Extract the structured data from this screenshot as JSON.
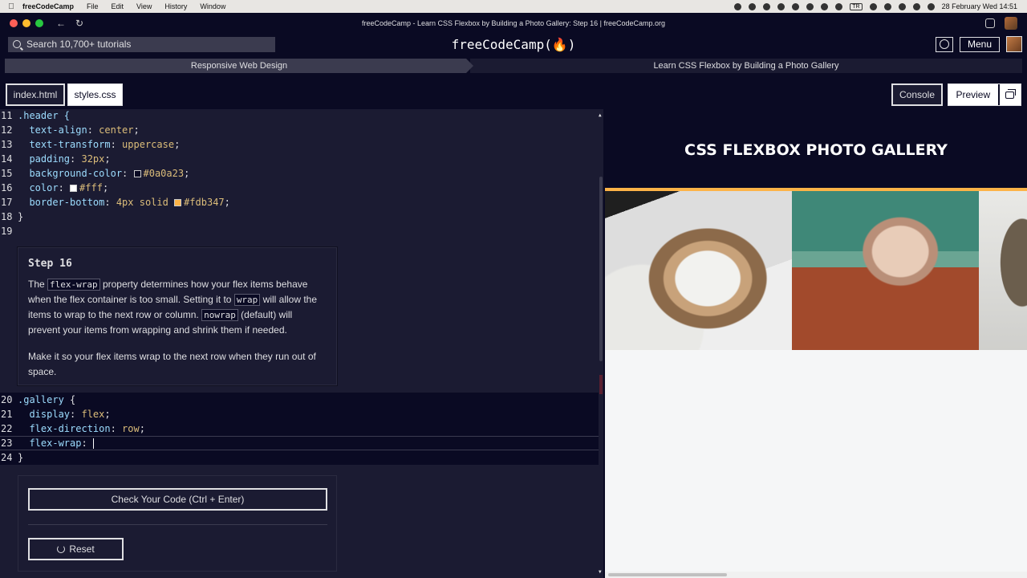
{
  "menubar": {
    "app_name": "freeCodeCamp",
    "items": [
      "File",
      "Edit",
      "View",
      "History",
      "Window"
    ],
    "lang_badge": "TR",
    "datetime": "28 February Wed  14:51"
  },
  "browser": {
    "window_title": "freeCodeCamp - Learn CSS Flexbox by Building a Photo Gallery: Step 16 | freeCodeCamp.org"
  },
  "nav": {
    "search_placeholder": "Search 10,700+ tutorials",
    "logo": "freeCodeCamp(🔥)",
    "menu_label": "Menu"
  },
  "breadcrumb": {
    "superblock": "Responsive Web Design",
    "block": "Learn CSS Flexbox by Building a Photo Gallery"
  },
  "tabs": {
    "file1": "index.html",
    "file2": "styles.css",
    "console": "Console",
    "preview": "Preview"
  },
  "code_top": [
    {
      "n": "11",
      "tokens": [
        {
          "c": "k-sel",
          "t": ".header {"
        }
      ]
    },
    {
      "n": "12",
      "tokens": [
        {
          "c": "k-prop",
          "t": "  text-align"
        },
        {
          "c": "code",
          "t": ": "
        },
        {
          "c": "k-val",
          "t": "center"
        },
        {
          "c": "code",
          "t": ";"
        }
      ]
    },
    {
      "n": "13",
      "tokens": [
        {
          "c": "k-prop",
          "t": "  text-transform"
        },
        {
          "c": "code",
          "t": ": "
        },
        {
          "c": "k-val",
          "t": "uppercase"
        },
        {
          "c": "code",
          "t": ";"
        }
      ]
    },
    {
      "n": "14",
      "tokens": [
        {
          "c": "k-prop",
          "t": "  padding"
        },
        {
          "c": "code",
          "t": ": "
        },
        {
          "c": "k-val",
          "t": "32px"
        },
        {
          "c": "code",
          "t": ";"
        }
      ]
    },
    {
      "n": "15",
      "tokens": [
        {
          "c": "k-prop",
          "t": "  background-color"
        },
        {
          "c": "code",
          "t": ": "
        },
        {
          "c": "swatch",
          "t": "#0a0a23"
        },
        {
          "c": "k-val",
          "t": "#0a0a23"
        },
        {
          "c": "code",
          "t": ";"
        }
      ]
    },
    {
      "n": "16",
      "tokens": [
        {
          "c": "k-prop",
          "t": "  color"
        },
        {
          "c": "code",
          "t": ": "
        },
        {
          "c": "swatch",
          "t": "#ffffff"
        },
        {
          "c": "k-val",
          "t": "#fff"
        },
        {
          "c": "code",
          "t": ";"
        }
      ]
    },
    {
      "n": "17",
      "tokens": [
        {
          "c": "k-prop",
          "t": "  border-bottom"
        },
        {
          "c": "code",
          "t": ": "
        },
        {
          "c": "k-val",
          "t": "4px solid "
        },
        {
          "c": "swatch",
          "t": "#fdb347"
        },
        {
          "c": "k-val",
          "t": "#fdb347"
        },
        {
          "c": "code",
          "t": ";"
        }
      ]
    },
    {
      "n": "18",
      "tokens": [
        {
          "c": "code",
          "t": "}"
        }
      ]
    },
    {
      "n": "19",
      "tokens": []
    }
  ],
  "step": {
    "title": "Step 16",
    "p1_a": "The ",
    "p1_code1": "flex-wrap",
    "p1_b": " property determines how your flex items behave when the flex container is too small. Setting it to ",
    "p1_code2": "wrap",
    "p1_c": " will allow the items to wrap to the next row or column. ",
    "p1_code3": "nowrap",
    "p1_d": " (default) will prevent your items from wrapping and shrink them if needed.",
    "p2": "Make it so your flex items wrap to the next row when they run out of space."
  },
  "code_bottom": [
    {
      "n": "20",
      "tokens": [
        {
          "c": "k-sel",
          "t": ".gallery"
        },
        {
          "c": "code",
          "t": " {"
        }
      ]
    },
    {
      "n": "21",
      "tokens": [
        {
          "c": "k-prop",
          "t": "  display"
        },
        {
          "c": "code",
          "t": ": "
        },
        {
          "c": "k-val",
          "t": "flex"
        },
        {
          "c": "code",
          "t": ";"
        }
      ]
    },
    {
      "n": "22",
      "tokens": [
        {
          "c": "k-prop",
          "t": "  flex-direction"
        },
        {
          "c": "code",
          "t": ": "
        },
        {
          "c": "k-val",
          "t": "row"
        },
        {
          "c": "code",
          "t": ";"
        }
      ]
    },
    {
      "n": "23",
      "tokens": [
        {
          "c": "k-prop",
          "t": "  flex-wrap"
        },
        {
          "c": "code",
          "t": ": "
        }
      ]
    },
    {
      "n": "24",
      "tokens": [
        {
          "c": "code",
          "t": "}"
        }
      ]
    }
  ],
  "actions": {
    "check": "Check Your Code (Ctrl + Enter)",
    "reset": "Reset"
  },
  "preview": {
    "heading": "CSS Flexbox Photo Gallery"
  },
  "colors": {
    "bg": "#0a0a23",
    "panel": "#1b1b32",
    "accent_border": "#fdb347"
  }
}
